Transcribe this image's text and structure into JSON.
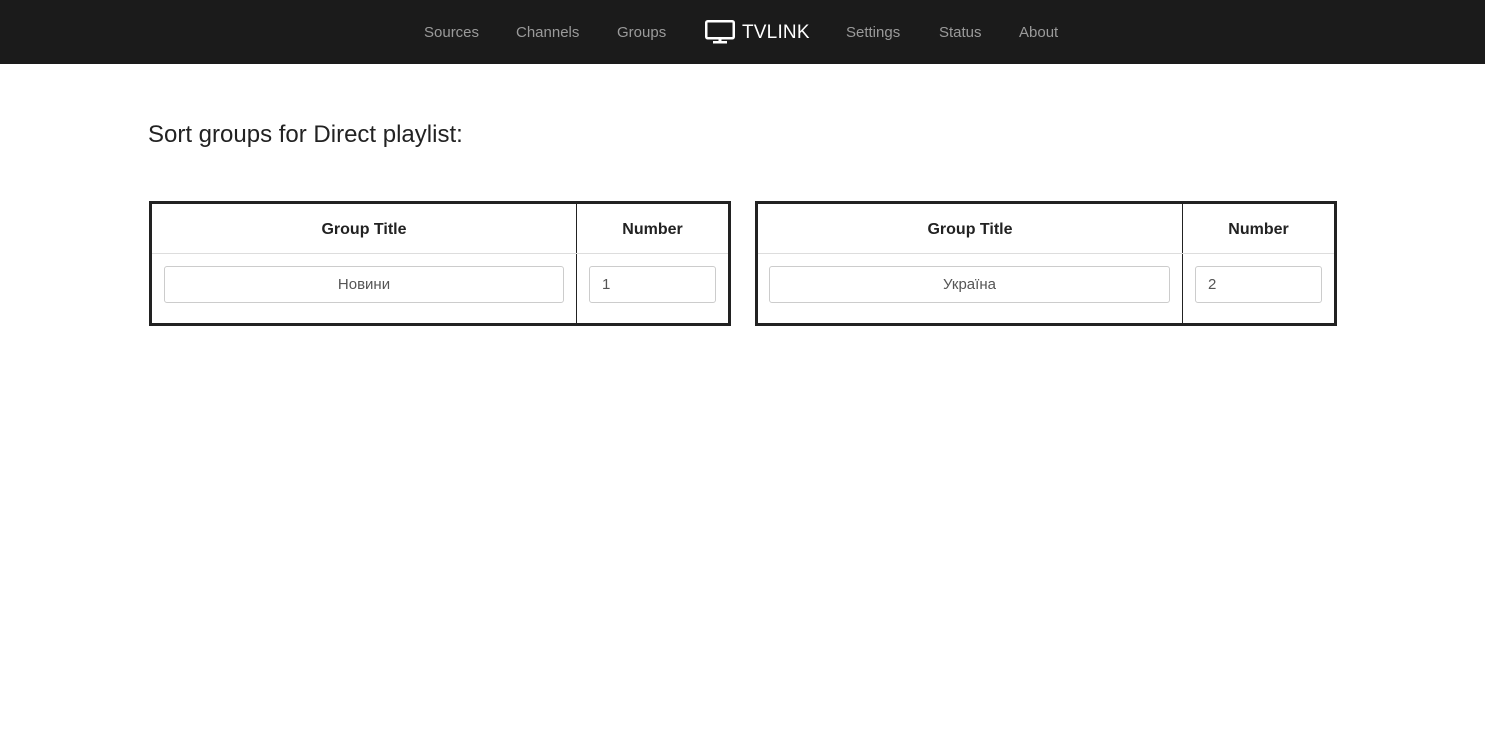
{
  "nav": {
    "left_items": [
      {
        "label": "Sources"
      },
      {
        "label": "Channels"
      },
      {
        "label": "Groups"
      }
    ],
    "brand": {
      "label": "TVLINK",
      "icon": "tv-monitor-icon"
    },
    "right_items": [
      {
        "label": "Settings"
      },
      {
        "label": "Status"
      },
      {
        "label": "About"
      }
    ]
  },
  "page": {
    "title": "Sort groups for Direct playlist:"
  },
  "tables": [
    {
      "headers": {
        "group_title": "Group Title",
        "number": "Number"
      },
      "row": {
        "group_title": "Новини",
        "number": "1"
      }
    },
    {
      "headers": {
        "group_title": "Group Title",
        "number": "Number"
      },
      "row": {
        "group_title": "Україна",
        "number": "2"
      }
    }
  ],
  "colors": {
    "navbar_bg": "#1b1b1b",
    "nav_text": "#9a9a9a",
    "brand_text": "#ffffff",
    "table_border": "#222222"
  }
}
